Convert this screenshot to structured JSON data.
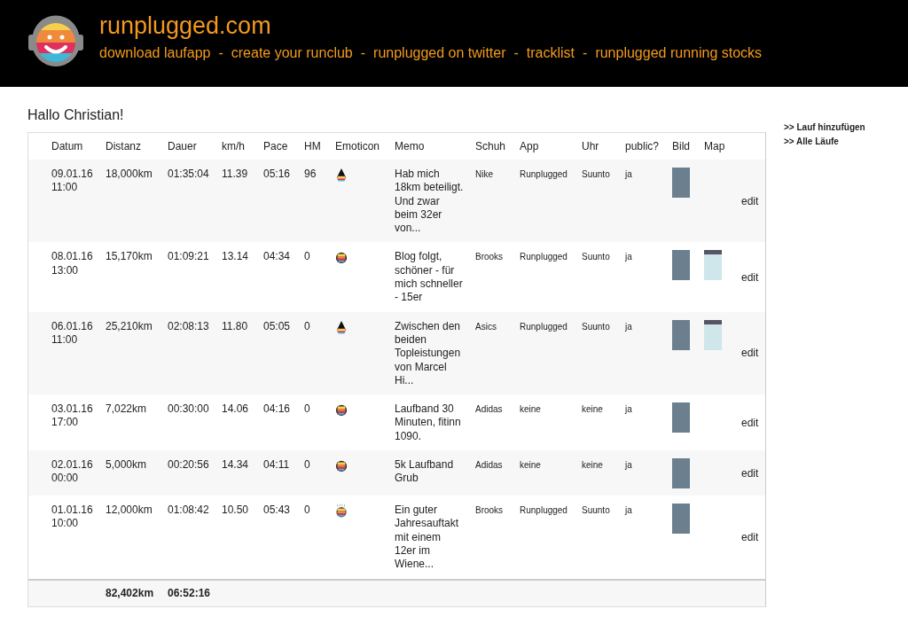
{
  "header": {
    "site_title": "runplugged.com",
    "nav": [
      "download laufapp",
      "create your runclub",
      "runplugged on twitter",
      "tracklist",
      "runplugged running stocks"
    ],
    "separator": "-"
  },
  "greeting": "Hallo Christian!",
  "table": {
    "columns": [
      "Datum",
      "Distanz",
      "Dauer",
      "km/h",
      "Pace",
      "HM",
      "Emoticon",
      "Memo",
      "Schuh",
      "App",
      "Uhr",
      "public?",
      "Bild",
      "Map"
    ],
    "rows": [
      {
        "date": "09.01.16 11:00",
        "distance": "18,000km",
        "duration": "01:35:04",
        "speed": "11.39",
        "pace": "05:16",
        "hm": "96",
        "emoticon": {
          "kind": "hood"
        },
        "memo": "Hab mich 18km beteiligt. Und zwar beim 32er von...",
        "shoe": "Nike",
        "app": "Runplugged",
        "watch": "Suunto",
        "public": "ja",
        "map": false,
        "action": "edit"
      },
      {
        "date": "08.01.16 13:00",
        "distance": "15,170km",
        "duration": "01:09:21",
        "speed": "13.14",
        "pace": "04:34",
        "hm": "0",
        "emoticon": {
          "kind": "headphones"
        },
        "memo": "Blog folgt, schöner - für mich schneller - 15er",
        "shoe": "Brooks",
        "app": "Runplugged",
        "watch": "Suunto",
        "public": "ja",
        "map": true,
        "action": "edit"
      },
      {
        "date": "06.01.16 11:00",
        "distance": "25,210km",
        "duration": "02:08:13",
        "speed": "11.80",
        "pace": "05:05",
        "hm": "0",
        "emoticon": {
          "kind": "hood"
        },
        "memo": "Zwischen den beiden Topleistungen von Marcel Hi...",
        "shoe": "Asics",
        "app": "Runplugged",
        "watch": "Suunto",
        "public": "ja",
        "map": true,
        "action": "edit"
      },
      {
        "date": "03.01.16 17:00",
        "distance": "7,022km",
        "duration": "00:30:00",
        "speed": "14.06",
        "pace": "04:16",
        "hm": "0",
        "emoticon": {
          "kind": "headphones"
        },
        "memo": "Laufband 30 Minuten, fitinn 1090.",
        "shoe": "Adidas",
        "app": "keine",
        "watch": "keine",
        "public": "ja",
        "map": false,
        "action": "edit"
      },
      {
        "date": "02.01.16 00:00",
        "distance": "5,000km",
        "duration": "00:20:56",
        "speed": "14.34",
        "pace": "04:11",
        "hm": "0",
        "emoticon": {
          "kind": "headphones"
        },
        "memo": "5k Laufband Grub",
        "shoe": "Adidas",
        "app": "keine",
        "watch": "keine",
        "public": "ja",
        "map": false,
        "action": "edit"
      },
      {
        "date": "01.01.16 10:00",
        "distance": "12,000km",
        "duration": "01:08:42",
        "speed": "10.50",
        "pace": "05:43",
        "hm": "0",
        "emoticon": {
          "kind": "sweat"
        },
        "memo": "Ein guter Jahresauftakt mit einem 12er im Wiene...",
        "shoe": "Brooks",
        "app": "Runplugged",
        "watch": "Suunto",
        "public": "ja",
        "map": false,
        "action": "edit"
      }
    ],
    "totals": {
      "distance": "82,402km",
      "duration": "06:52:16"
    }
  },
  "sidebar": {
    "links": [
      ">> Lauf hinzufügen",
      ">> Alle Läufe"
    ]
  }
}
